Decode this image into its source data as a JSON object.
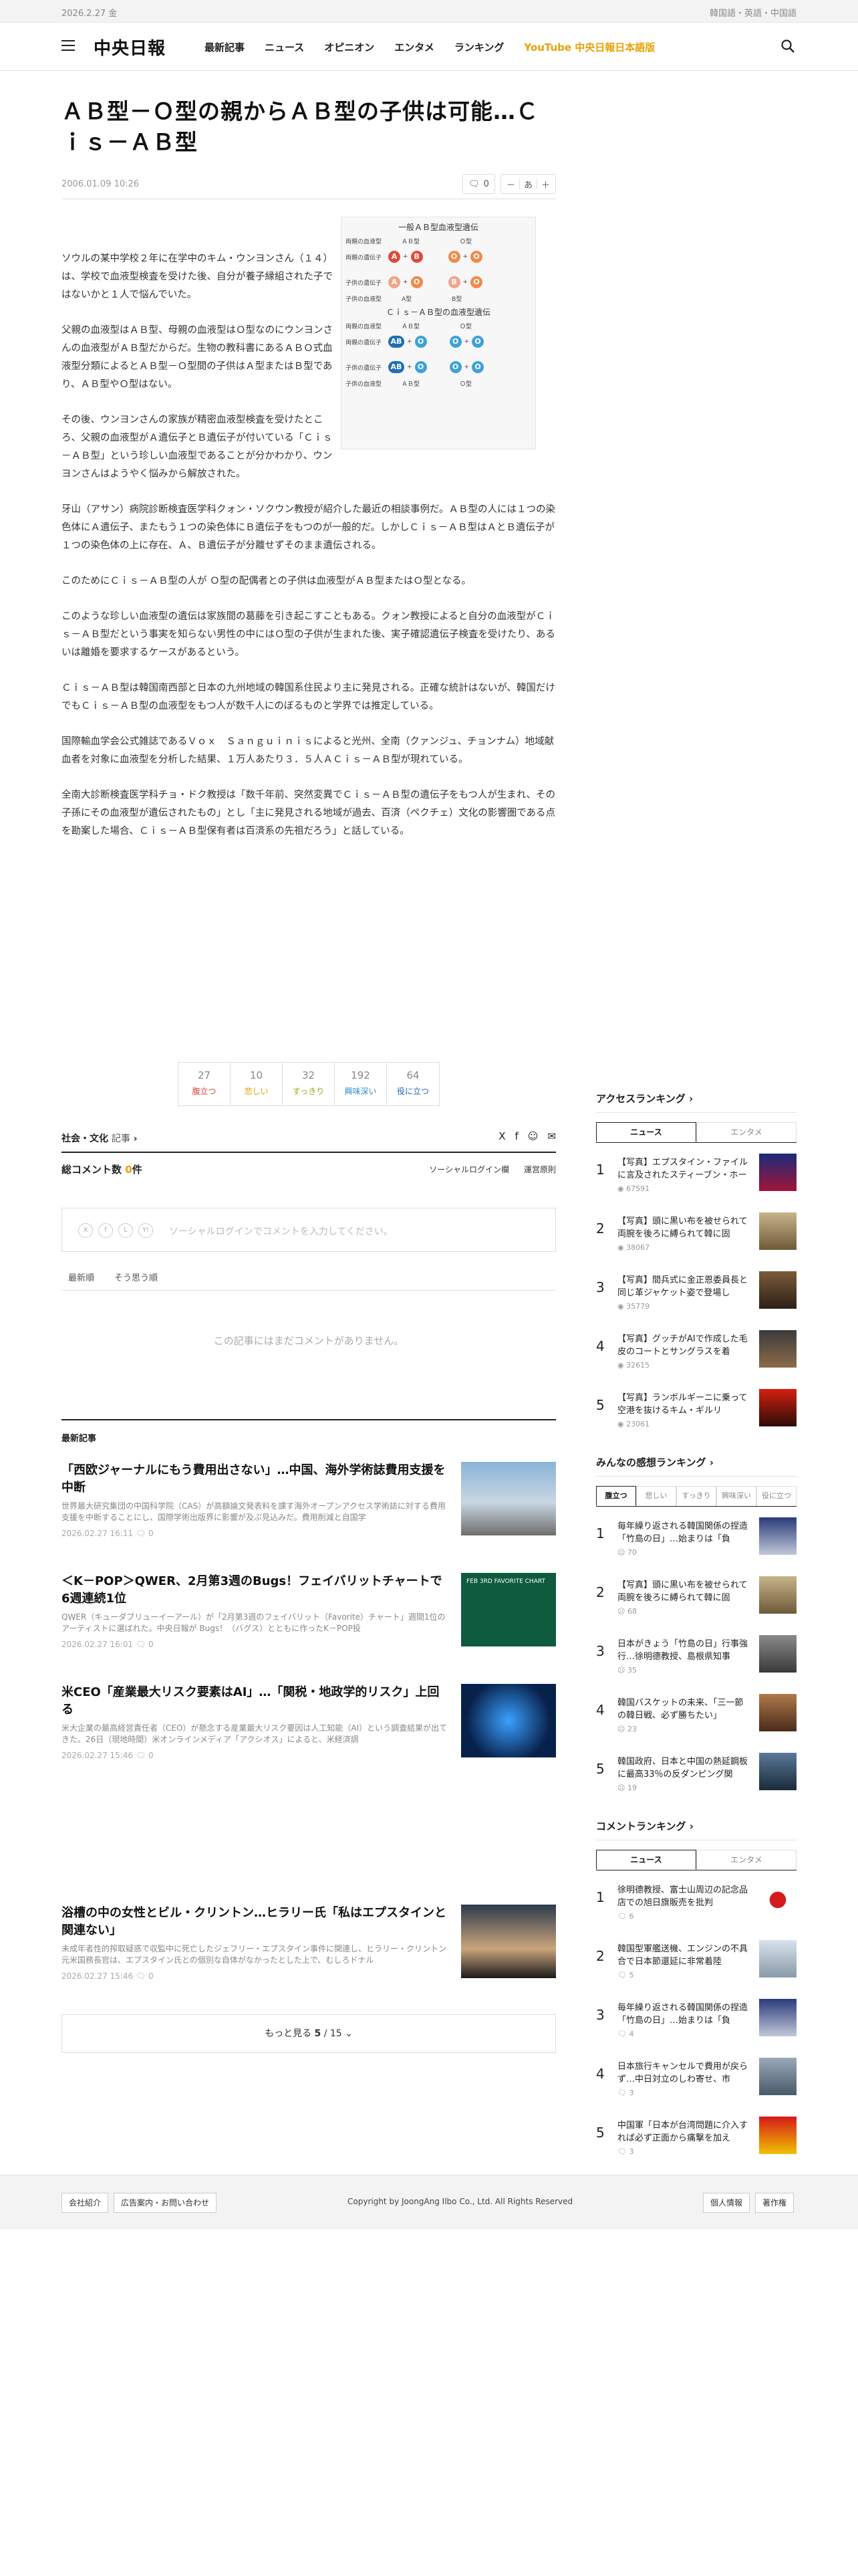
{
  "topbar": {
    "date": "2026.2.27 金",
    "langs": "韓国語・英語・中国語"
  },
  "header": {
    "logo": "中央日報",
    "nav": [
      "最新記事",
      "ニュース",
      "オピニオン",
      "エンタメ",
      "ランキング",
      "YouTube 中央日報日本語版"
    ]
  },
  "article": {
    "headline": "ＡＢ型－Ｏ型の親からＡＢ型の子供は可能…Ｃｉｓ－ＡＢ型",
    "time": "2006.01.09 10:26",
    "comment_count": "0",
    "font_label": "あ",
    "figure": {
      "title1": "一般ＡＢ型血液型遺伝",
      "title2": "Ｃｉｓ－ＡＢ型の血液型遺伝",
      "rows": [
        "両親の血液型",
        "両親の遺伝子",
        "子供の遺伝子",
        "子供の血液型"
      ],
      "p1": "ＡＢ型",
      "p2": "Ｏ型",
      "c1": "ＡＢ型",
      "c2": "Ｏ型"
    },
    "paragraphs": [
      "ソウルの某中学校２年に在学中のキム・ウンヨンさん（１４）は、学校で血液型検査を受けた後、自分が養子縁組された子ではないかと１人で悩んでいた。",
      "父親の血液型はＡＢ型、母親の血液型はＯ型なのにウンヨンさんの血液型がＡＢ型だからだ。生物の教科書にあるＡＢＯ式血液型分類によるとＡＢ型－Ｏ型間の子供はＡ型またはＢ型であり、ＡＢ型やＯ型はない。",
      "その後、ウンヨンさんの家族が精密血液型検査を受けたところ、父親の血液型がＡ遺伝子とＢ遺伝子が付いている「Ｃｉｓ－ＡＢ型」という珍しい血液型であることが分かわかり、ウンヨンさんはようやく悩みから解放された。",
      "牙山（アサン）病院診断検査医学科クォン・ソクウン教授が紹介した最近の相談事例だ。ＡＢ型の人には１つの染色体にＡ遺伝子、またもう１つの染色体にＢ遺伝子をもつのが一般的だ。しかしＣｉｓ－ＡＢ型はＡとＢ遺伝子が１つの染色体の上に存在、Ａ、Ｂ遺伝子が分離せずそのまま遺伝される。",
      "このためにＣｉｓ－ＡＢ型の人が Ｏ型の配偶者との子供は血液型がＡＢ型またはＯ型となる。",
      "このような珍しい血液型の遺伝は家族間の葛藤を引き起こすこともある。クォン教授によると自分の血液型がＣｉｓ－ＡＢ型だという事実を知らない男性の中にはＯ型の子供が生まれた後、実子確認遺伝子検査を受けたり、あるいは離婚を要求するケースがあるという。",
      "Ｃｉｓ－ＡＢ型は韓国南西部と日本の九州地域の韓国系住民より主に発見される。正確な統計はないが、韓国だけでもＣｉｓ－ＡＢ型の血液型をもつ人が数千人にのぼるものと学界では推定している。",
      "国際輸血学会公式雑誌であるＶｏｘ　Ｓａｎｇｕｉｎｉｓによると光州、全南（クァンジュ、チョンナム）地域献血者を対象に血液型を分析した結果、１万人あたり３．５人ＡＣｉｓ－ＡＢ型が現れている。",
      "全南大診断検査医学科チョ・ドク教授は「数千年前、突然変異でＣｉｓ－ＡＢ型の遺伝子をもつ人が生まれ、その子孫にその血液型が遺伝されたもの」とし「主に発見される地域が過去、百済（ペクチェ）文化の影響圏である点を勘案した場合、Ｃｉｓ－ＡＢ型保有者は百済系の先祖だろう」と話している。"
    ],
    "reactions": [
      {
        "count": "27",
        "label": "腹立つ",
        "color": "#d9453b"
      },
      {
        "count": "10",
        "label": "悲しい",
        "color": "#e8a100"
      },
      {
        "count": "32",
        "label": "すっきり",
        "color": "#8ab31c"
      },
      {
        "count": "192",
        "label": "興味深い",
        "color": "#2a8dd0"
      },
      {
        "count": "64",
        "label": "役に立つ",
        "color": "#2266b5"
      }
    ],
    "category": "社会・文化",
    "category_suffix": "記事",
    "share": [
      "X",
      "f",
      "☺",
      "✉"
    ]
  },
  "comments": {
    "title_prefix": "総コメント数",
    "count": "0",
    "title_suffix": "件",
    "social_login": "ソーシャルログイン欄",
    "rules": "運営原則",
    "placeholder": "ソーシャルログインでコメントを入力してください。",
    "sort_latest": "最新順",
    "sort_agree": "そう思う順",
    "empty": "この記事にはまだコメントがありません。"
  },
  "latest": {
    "label": "最新記事",
    "items": [
      {
        "title": "「西欧ジャーナルにもう費用出さない」…中国、海外学術誌費用支援を中断",
        "desc": "世界最大研究集団の中国科学院（CAS）が高額論文発表料を課す海外オープンアクセス学術誌に対する費用支援を中断することにし、国際学術出版界に影響が及ぶ見込みだ。費用削減と自国学",
        "meta": "2026.02.27 16:11",
        "c": "0"
      },
      {
        "title": "＜K－POP＞QWER、2月第3週のBugs！フェイバリットチャートで6週連続1位",
        "desc": "QWER（キューダブリューイーアール）が「2月第3週のフェイバリット（Favorite）チャート」週間1位のアーティストに選ばれた。中央日報が Bugs！（バグス）とともに作ったK－POP投",
        "meta": "2026.02.27 16:01",
        "c": "0"
      },
      {
        "title": "米CEO「産業最大リスク要素はAI」…「関税・地政学的リスク」上回る",
        "desc": "米大企業の最高経営責任者（CEO）が懸念する産業最大リスク要因は人工知能（AI）という調査結果が出てきた。26日（現地時間）米オンラインメディア「アクシオス」によると、米経済調",
        "meta": "2026.02.27 15:46",
        "c": "0"
      },
      {
        "title": "浴槽の中の女性とビル・クリントン…ヒラリー氏「私はエプスタインと関連ない」",
        "desc": "未成年者性的搾取疑惑で収監中に死亡したジェフリー・エプスタイン事件に関連し、ヒラリー・クリントン元米国務長官は、エプスタイン氏との個別な自体がなかったとした上で、むしろドナル",
        "meta": "2026.02.27 15:46",
        "c": "0"
      }
    ],
    "thumb_text": "FEB 3RD FAVORITE CHART",
    "more_prefix": "もっと見る",
    "more_page": "5",
    "more_total": "/ 15"
  },
  "access_ranking": {
    "title": "アクセスランキング",
    "tabs": [
      "ニュース",
      "エンタメ"
    ],
    "items": [
      {
        "title": "【写真】エプスタイン・ファイルに言及されたスティーブン・ホー",
        "views": "67591"
      },
      {
        "title": "【写真】頭に黒い布を被せられて両腕を後ろに縛られて韓に固",
        "views": "38067"
      },
      {
        "title": "【写真】間兵式に金正恩委員長と同じ革ジャケット姿で登場し",
        "views": "35779"
      },
      {
        "title": "【写真】グッチがAIで作成した毛皮のコートとサングラスを着",
        "views": "32615"
      },
      {
        "title": "【写真】ランボルギーニに乗って空港を抜けるキム・ギルリ",
        "views": "23061"
      }
    ]
  },
  "reaction_ranking": {
    "title": "みんなの感想ランキング",
    "tabs": [
      "腹立つ",
      "悲しい",
      "すっきり",
      "興味深い",
      "役に立つ"
    ],
    "items": [
      {
        "title": "毎年繰り返される韓国関係の捏造「竹島の日」…始まりは「負",
        "views": "70"
      },
      {
        "title": "【写真】頭に黒い布を被せられて両腕を後ろに縛られて韓に固",
        "views": "68"
      },
      {
        "title": "日本がきょう「竹島の日」行事強行…徐明德教授、島根県知事",
        "views": "35"
      },
      {
        "title": "韓国バスケットの未来、「三一節の韓日戦、必ず勝ちたい」",
        "views": "23"
      },
      {
        "title": "韓国政府、日本と中国の熱延鋼板に最高33％の反ダンピング関",
        "views": "19"
      }
    ]
  },
  "comment_ranking": {
    "title": "コメントランキング",
    "tabs": [
      "ニュース",
      "エンタメ"
    ],
    "items": [
      {
        "title": "徐明德教授、富士山周辺の記念品店での旭日旗販売を批判",
        "views": "6"
      },
      {
        "title": "韓国型軍艦送機、エンジンの不具合で日本節還延に非常着陸",
        "views": "5"
      },
      {
        "title": "毎年繰り返される韓国関係の捏造「竹島の日」…始まりは「負",
        "views": "4"
      },
      {
        "title": "日本旅行キャンセルで費用が戻らず…中日対立のしわ寄せ、市",
        "views": "3"
      },
      {
        "title": "中国軍「日本が台湾問題に介入すれば必ず正面から痛撃を加え",
        "views": "3"
      }
    ]
  },
  "footer": {
    "left": [
      "会社紹介",
      "広告案内・お問い合わせ"
    ],
    "copyright": "Copyright by JoongAng Ilbo Co., Ltd. All Rights Reserved",
    "right": [
      "個人情報",
      "著作権"
    ]
  }
}
